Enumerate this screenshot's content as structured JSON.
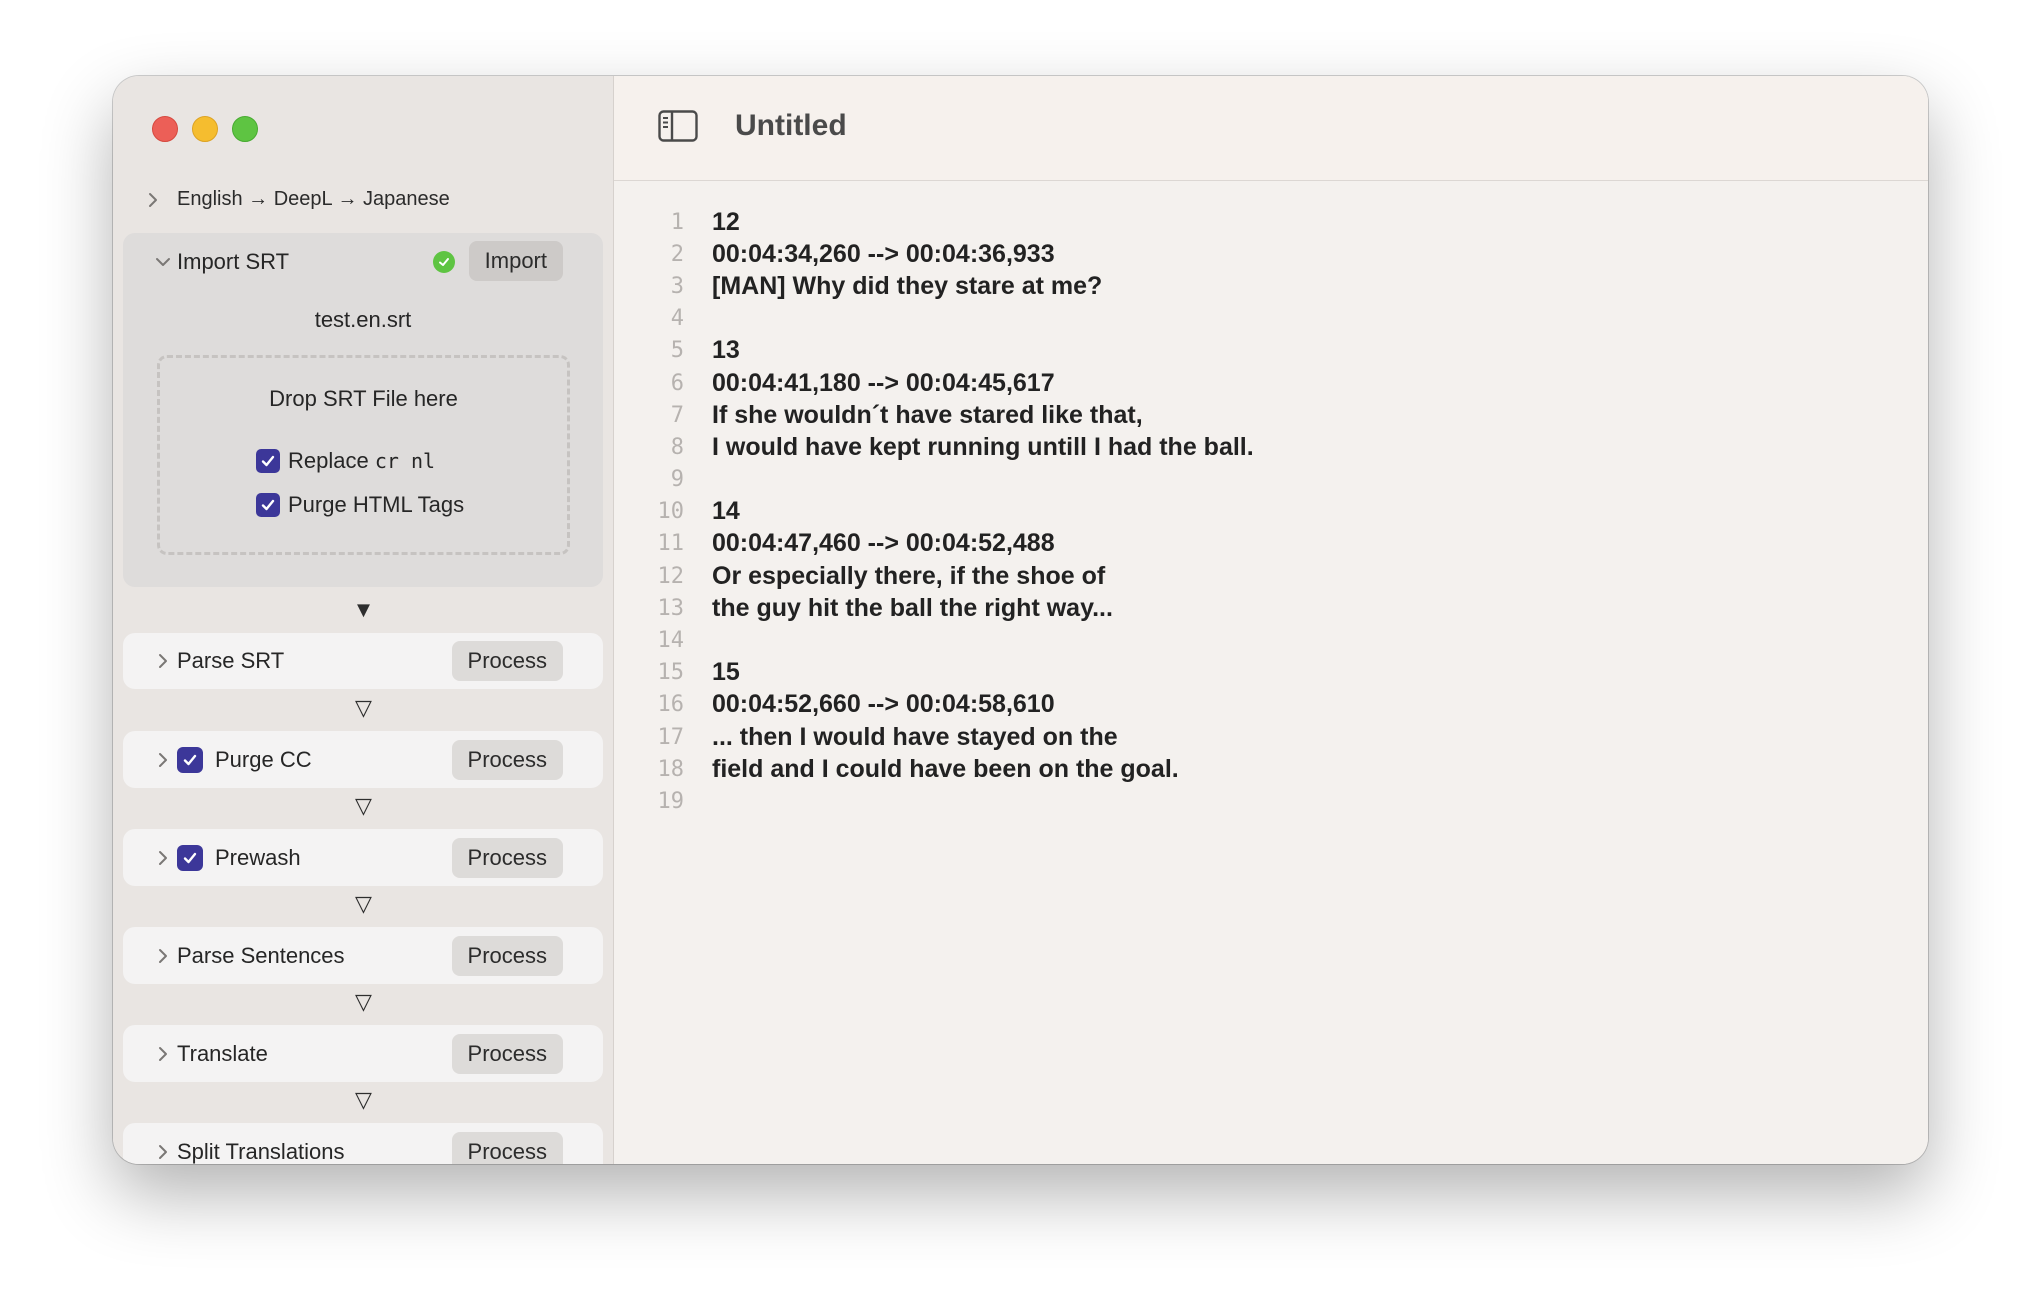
{
  "window": {
    "title": "Untitled"
  },
  "sidebar": {
    "breadcrumb": "English → DeepL → Japanese",
    "import": {
      "label": "Import SRT",
      "button": "Import",
      "filename": "test.en.srt",
      "drop_text": "Drop SRT File here",
      "option1_prefix": "Replace ",
      "option1_code": "cr nl",
      "option2": "Purge HTML Tags"
    },
    "arrow_filled": "▼",
    "arrow_hollow": "▽",
    "steps": [
      {
        "label": "Parse SRT",
        "button": "Process",
        "checked": false
      },
      {
        "label": "Purge CC",
        "button": "Process",
        "checked": true
      },
      {
        "label": "Prewash",
        "button": "Process",
        "checked": true
      },
      {
        "label": "Parse Sentences",
        "button": "Process",
        "checked": false
      },
      {
        "label": "Translate",
        "button": "Process",
        "checked": false
      },
      {
        "label": "Split Translations",
        "button": "Process",
        "checked": false
      }
    ]
  },
  "editor": {
    "lines": [
      {
        "n": "1",
        "t": "12"
      },
      {
        "n": "2",
        "t": "00:04:34,260 --> 00:04:36,933"
      },
      {
        "n": "3",
        "t": "[MAN] Why did they stare at me?"
      },
      {
        "n": "4",
        "t": ""
      },
      {
        "n": "5",
        "t": "13"
      },
      {
        "n": "6",
        "t": "00:04:41,180 --> 00:04:45,617"
      },
      {
        "n": "7",
        "t": "If she wouldn´t have stared like that,"
      },
      {
        "n": "8",
        "t": "I would have kept running untill I had the ball."
      },
      {
        "n": "9",
        "t": ""
      },
      {
        "n": "10",
        "t": "14"
      },
      {
        "n": "11",
        "t": "00:04:47,460 --> 00:04:52,488"
      },
      {
        "n": "12",
        "t": "Or especially there, if the shoe of"
      },
      {
        "n": "13",
        "t": "the guy hit the ball the right way..."
      },
      {
        "n": "14",
        "t": ""
      },
      {
        "n": "15",
        "t": "15"
      },
      {
        "n": "16",
        "t": "00:04:52,660 --> 00:04:58,610"
      },
      {
        "n": "17",
        "t": "... then I would have stayed on the"
      },
      {
        "n": "18",
        "t": "field and I could have been on the goal."
      },
      {
        "n": "19",
        "t": ""
      }
    ]
  },
  "colors": {
    "accent_checkbox": "#3c3799",
    "success": "#5ec442",
    "close": "#ec5f57",
    "minimize": "#f5bd2f",
    "zoom": "#5ec442"
  }
}
